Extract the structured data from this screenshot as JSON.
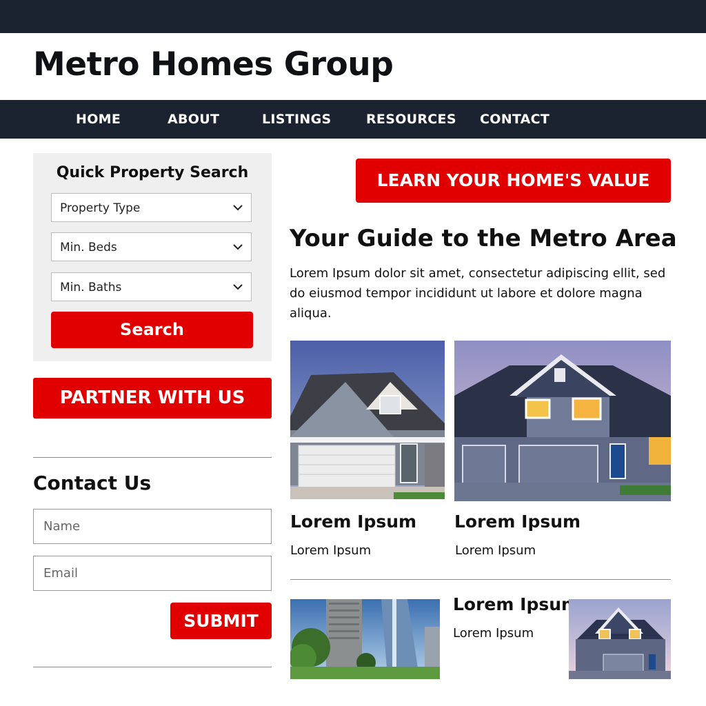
{
  "brand": "Metro Homes Group",
  "nav": [
    "HOME",
    "ABOUT",
    "LISTINGS",
    "RESOURCES",
    "CONTACT"
  ],
  "quick_search": {
    "title": "Quick Property Search",
    "selects": [
      "Property Type",
      "Min. Beds",
      "Min. Baths"
    ],
    "button": "Search"
  },
  "partner_button": "PARTNER WITH US",
  "contact": {
    "title": "Contact Us",
    "name_placeholder": "Name",
    "email_placeholder": "Email",
    "submit": "SUBMIT"
  },
  "value_button": "LEARN YOUR HOME'S VALUE",
  "guide": {
    "title": "Your Guide to the Metro Area",
    "intro": "Lorem Ipsum dolor sit amet, consectetur adipiscing ellit,  sed do eiusmod tempor incididunt ut labore et dolore magna aliqua."
  },
  "cards": [
    {
      "title": "Lorem Ipsum",
      "subtitle": "Lorem Ipsum"
    },
    {
      "title": "Lorem Ipsum",
      "subtitle": "Lorem Ipsum"
    }
  ],
  "feature": {
    "title": "Lorem Ipsum",
    "subtitle": "Lorem Ipsum"
  },
  "colors": {
    "dark": "#1b2331",
    "accent": "#e00000",
    "panel": "#efefef"
  },
  "icons": {
    "select": "chevron-down-icon"
  }
}
